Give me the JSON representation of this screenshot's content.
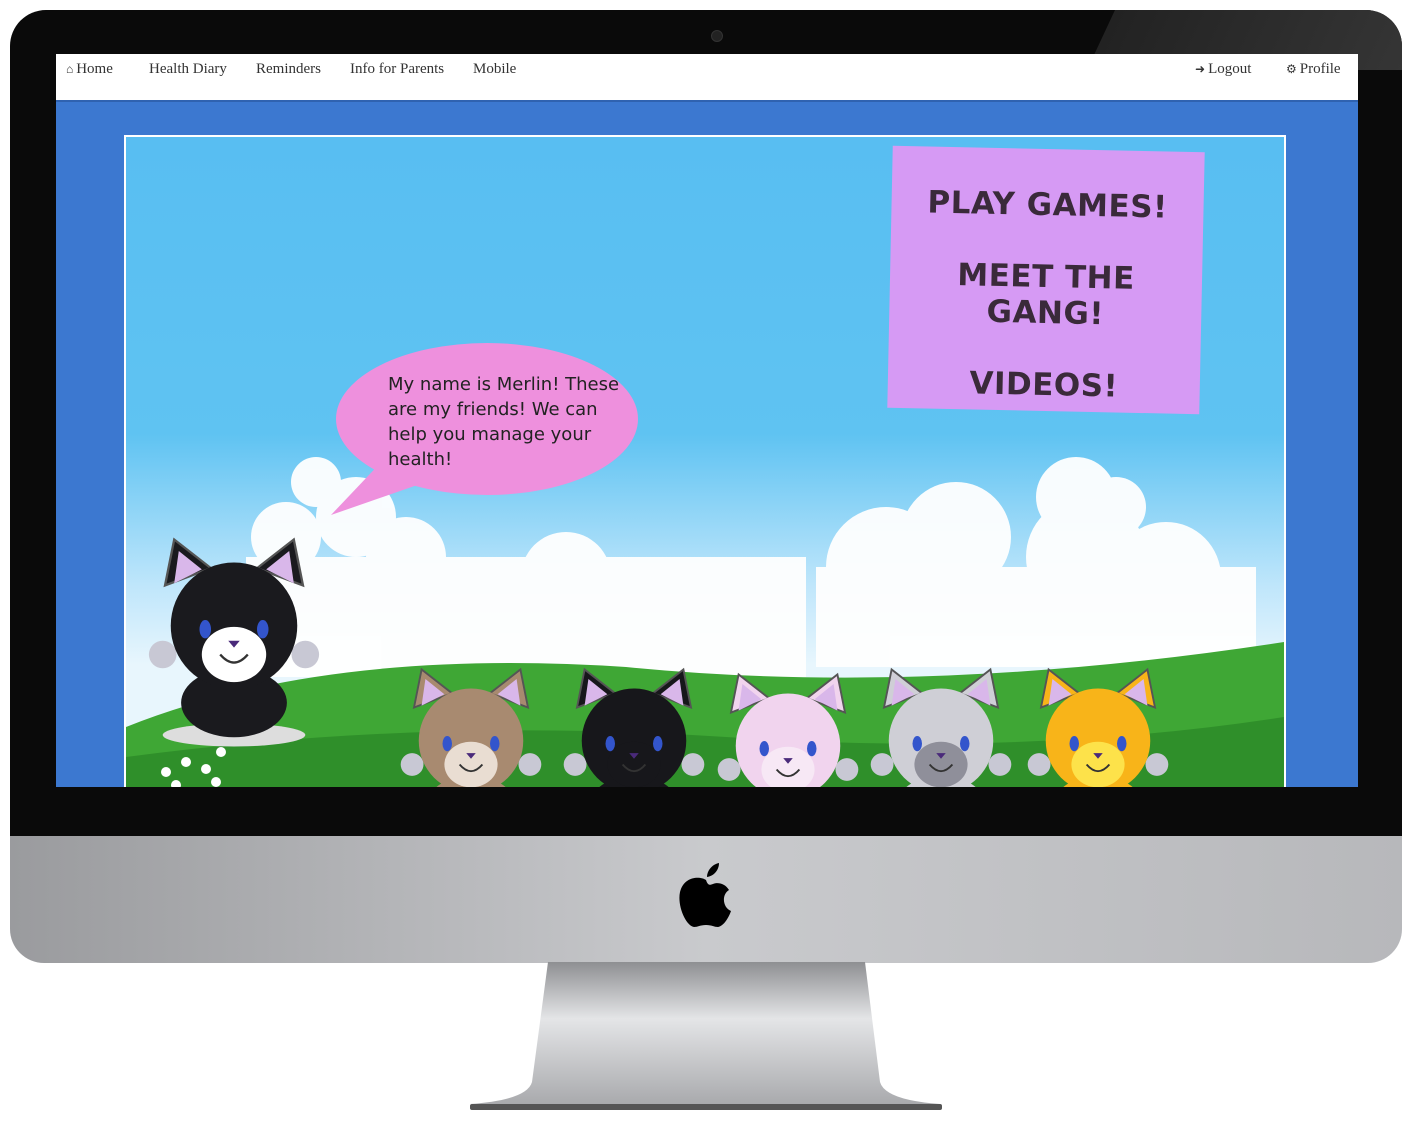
{
  "nav": {
    "left": [
      {
        "label": "Home",
        "icon": "home-icon"
      },
      {
        "label": "Health Diary"
      },
      {
        "label": "Reminders"
      },
      {
        "label": "Info for Parents"
      },
      {
        "label": "Mobile"
      }
    ],
    "right": [
      {
        "label": "Logout",
        "icon": "logout-icon"
      },
      {
        "label": "Profile",
        "icon": "gear-icon"
      }
    ]
  },
  "note": {
    "line1": "PLAY GAMES!",
    "line2": "MEET THE",
    "line3": "GANG!",
    "line4": "VIDEOS!"
  },
  "bubble": {
    "text": "My name is Merlin! These are my friends! We can help you manage your health!"
  },
  "colors": {
    "page_bg": "#3c78d0",
    "note": "#d69af4",
    "bubble": "#ee90dd",
    "grass": "#3fa735"
  }
}
